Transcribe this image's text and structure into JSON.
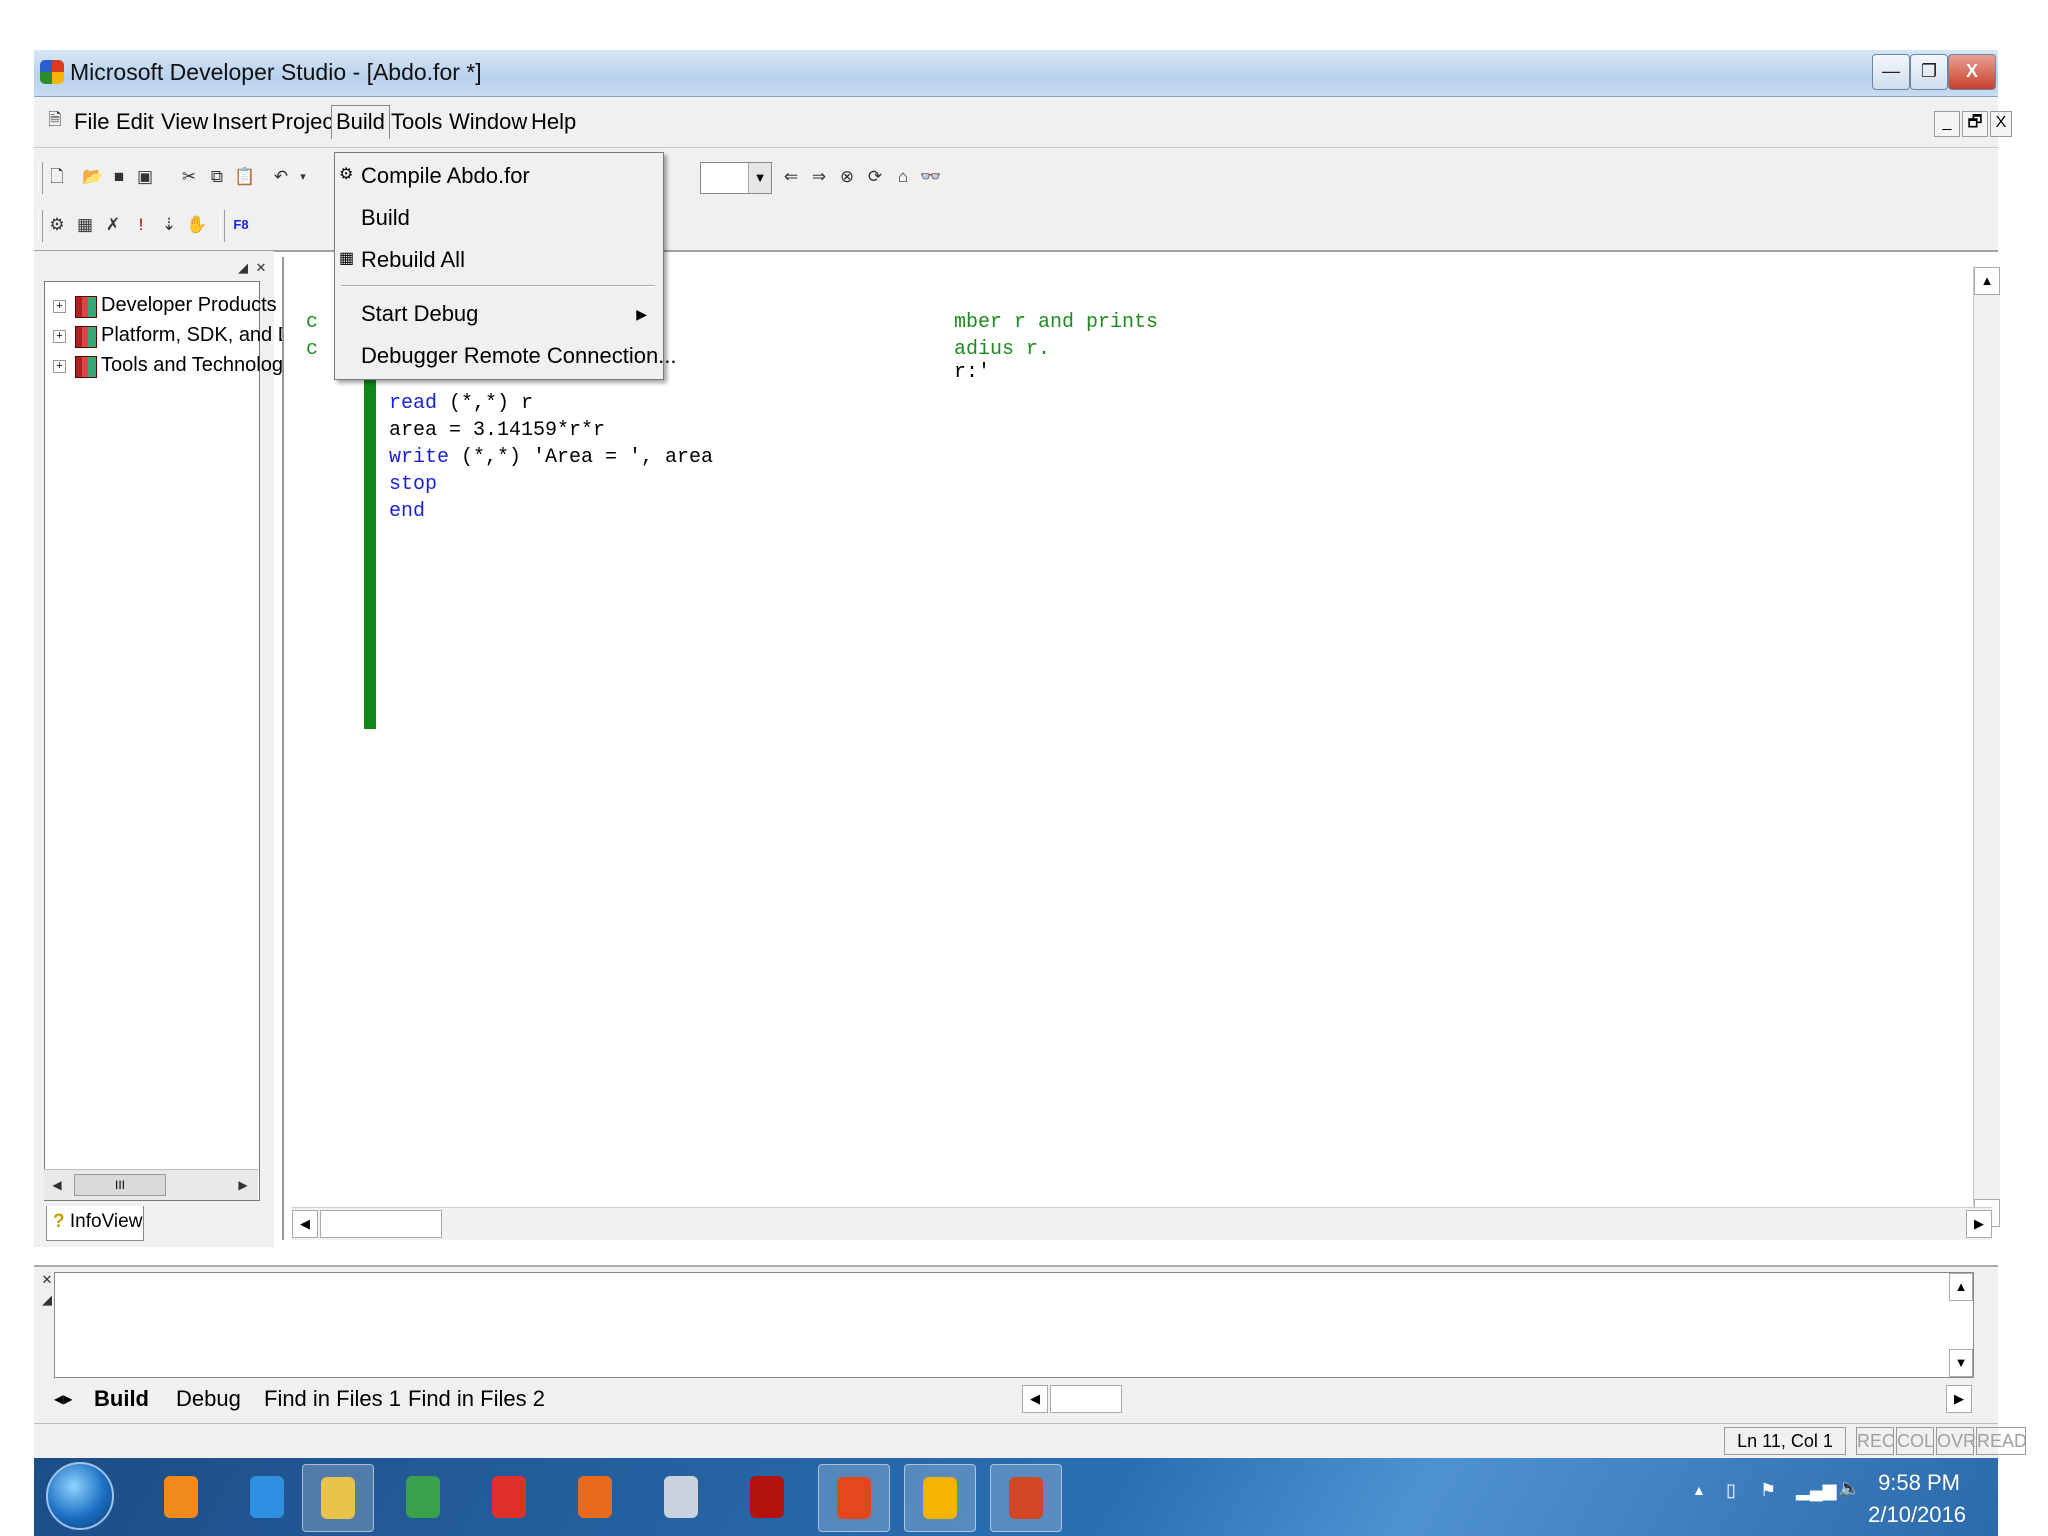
{
  "window": {
    "title": "Microsoft Developer Studio - [Abdo.for *]",
    "minimize_glyph": "—",
    "restore_glyph": "❐",
    "close_glyph": "X"
  },
  "menubar": {
    "items": [
      "File",
      "Edit",
      "View",
      "Insert",
      "Project",
      "Build",
      "Tools",
      "Window",
      "Help"
    ],
    "mdi_min": "_",
    "mdi_restore": "🗗",
    "mdi_close": "X"
  },
  "build_menu": {
    "items": [
      {
        "label": "Compile Abdo.for",
        "icon": "compile-icon"
      },
      {
        "label": "Build",
        "icon": ""
      },
      {
        "label": "Rebuild All",
        "icon": "rebuild-icon"
      },
      {
        "label": "Start Debug",
        "icon": "",
        "submenu": true
      },
      {
        "label": "Debugger Remote Connection...",
        "icon": ""
      }
    ]
  },
  "workspace": {
    "tree": [
      {
        "label": "Developer Products"
      },
      {
        "label": "Platform, SDK, and DI"
      },
      {
        "label": "Tools and Technolog"
      }
    ],
    "tab_label": "InfoView",
    "scroll_thumb_glyph": "III"
  },
  "editor": {
    "comment_lines": [
      {
        "prefix": "c",
        "tail": "mber r and prints"
      },
      {
        "prefix": "c",
        "tail": "adius r."
      }
    ],
    "partial_line": "r:'",
    "code_lines": [
      {
        "kw": "read",
        "rest": " (*,*) r"
      },
      {
        "kw": "",
        "rest": "area = 3.14159*r*r"
      },
      {
        "kw": "write",
        "rest": " (*,*) 'Area = ', area"
      },
      {
        "kw": "stop",
        "rest": ""
      },
      {
        "kw": "end",
        "rest": ""
      }
    ]
  },
  "output": {
    "tabs": [
      "Build",
      "Debug",
      "Find in Files 1",
      "Find in Files 2"
    ],
    "active_tab": "Build"
  },
  "statusbar": {
    "position": "Ln 11, Col 1",
    "indicators": [
      "REC",
      "COL",
      "OVR",
      "READ"
    ]
  },
  "taskbar": {
    "time": "9:58 PM",
    "date": "2/10/2016",
    "apps": [
      {
        "name": "media-player-icon",
        "color": "#f08a1c"
      },
      {
        "name": "internet-explorer-icon",
        "color": "#2f8fe0"
      },
      {
        "name": "file-explorer-icon",
        "color": "#e8c34a"
      },
      {
        "name": "chrome-icon",
        "color": "#3aa04a"
      },
      {
        "name": "app-n-icon",
        "color": "#e0302a"
      },
      {
        "name": "firefox-icon",
        "color": "#e86a1a"
      },
      {
        "name": "calculator-icon",
        "color": "#c9d2de"
      },
      {
        "name": "acrobat-icon",
        "color": "#b3120f"
      },
      {
        "name": "app-ec-icon",
        "color": "#e4471e"
      },
      {
        "name": "developer-studio-icon",
        "color": "#f4b400"
      },
      {
        "name": "powerpoint-icon",
        "color": "#d24726"
      }
    ]
  },
  "colors": {
    "margin_bar": "#11871a",
    "keyword": "#1a24d6",
    "comment": "#1f8a1f"
  }
}
